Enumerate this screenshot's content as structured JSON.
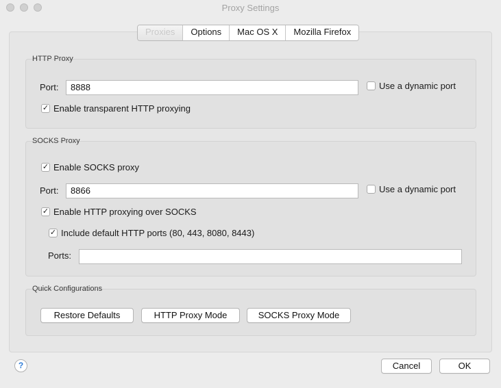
{
  "window": {
    "title": "Proxy Settings"
  },
  "tabs": [
    {
      "label": "Proxies"
    },
    {
      "label": "Options"
    },
    {
      "label": "Mac OS X"
    },
    {
      "label": "Mozilla Firefox"
    }
  ],
  "http_proxy": {
    "group_title": "HTTP Proxy",
    "port_label": "Port:",
    "port_value": "8888",
    "dynamic_port_label": "Use a dynamic port",
    "dynamic_port_checked": false,
    "transparent_label": "Enable transparent HTTP proxying",
    "transparent_checked": true
  },
  "socks_proxy": {
    "group_title": "SOCKS Proxy",
    "enable_label": "Enable SOCKS proxy",
    "enable_checked": true,
    "port_label": "Port:",
    "port_value": "8866",
    "dynamic_port_label": "Use a dynamic port",
    "dynamic_port_checked": false,
    "http_over_socks_label": "Enable HTTP proxying over SOCKS",
    "http_over_socks_checked": true,
    "default_ports_label": "Include default HTTP ports (80, 443, 8080, 8443)",
    "default_ports_checked": true,
    "ports_label": "Ports:",
    "ports_value": ""
  },
  "quick_config": {
    "group_title": "Quick Configurations",
    "restore_label": "Restore Defaults",
    "http_mode_label": "HTTP Proxy Mode",
    "socks_mode_label": "SOCKS Proxy Mode"
  },
  "footer": {
    "help_glyph": "?",
    "cancel_label": "Cancel",
    "ok_label": "OK"
  },
  "check_glyph": "✓"
}
